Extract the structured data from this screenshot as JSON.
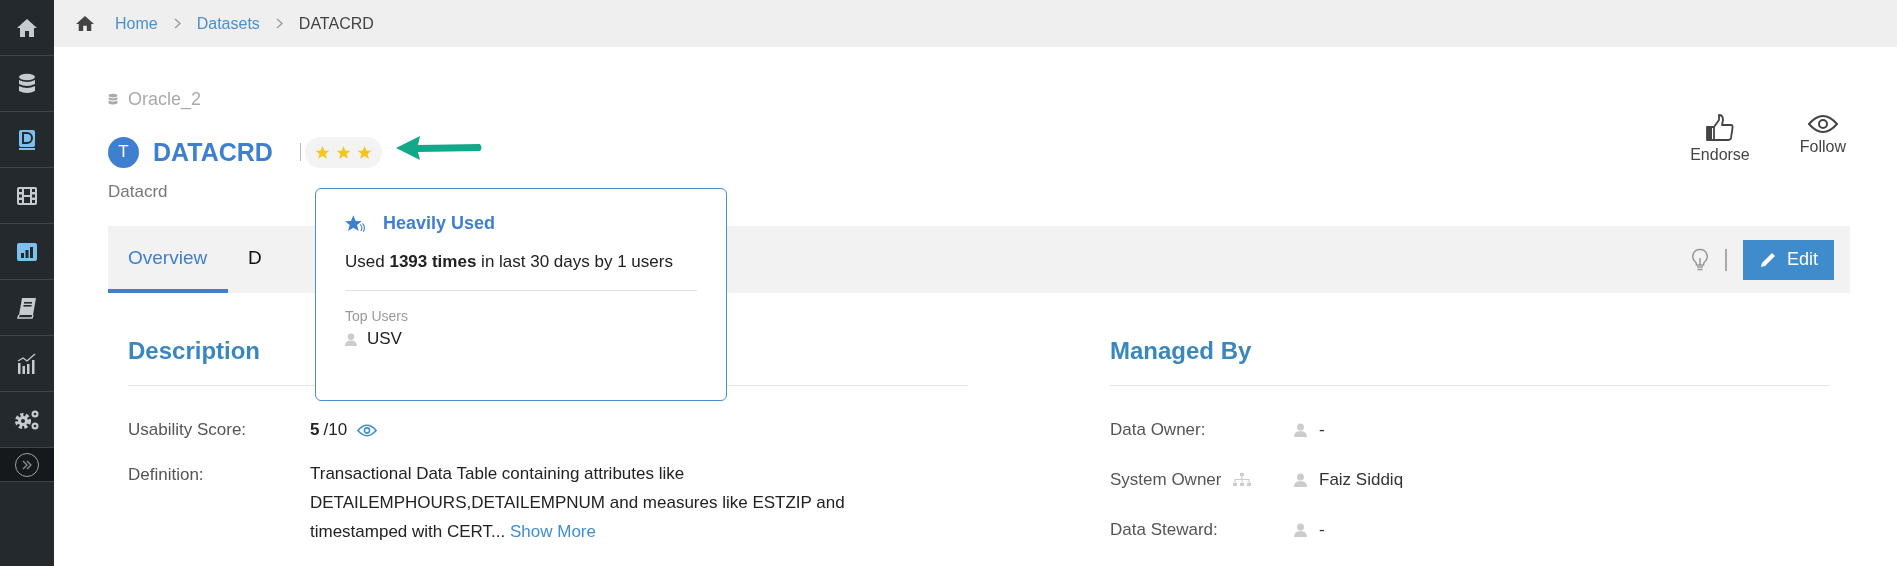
{
  "sidebar": {
    "items": [
      {
        "kind": "home"
      },
      {
        "kind": "database"
      },
      {
        "kind": "dictionary"
      },
      {
        "kind": "film"
      },
      {
        "kind": "chart"
      },
      {
        "kind": "book"
      },
      {
        "kind": "trend"
      },
      {
        "kind": "gears"
      }
    ]
  },
  "breadcrumb": [
    {
      "label": "Home",
      "link": true
    },
    {
      "label": "Datasets",
      "link": true
    },
    {
      "label": "DATACRD",
      "link": false
    }
  ],
  "header": {
    "source": "Oracle_2",
    "type_badge": "T",
    "title": "DATACRD",
    "stars": 3,
    "subtitle": "Datacrd",
    "actions": [
      {
        "kind": "endorse",
        "label": "Endorse"
      },
      {
        "kind": "follow",
        "label": "Follow"
      }
    ]
  },
  "tabs": [
    {
      "label": "Overview",
      "selected": true
    },
    {
      "label": "D",
      "selected": false
    }
  ],
  "edit_button": "Edit",
  "popover": {
    "title": "Heavily Used",
    "text": "Used **1393 times** in last 30 days by 1 users",
    "top_users_label": "Top Users",
    "top_users": [
      "USV"
    ]
  },
  "description": {
    "heading": "Description",
    "usability_label": "Usability Score:",
    "usability_score": "5",
    "usability_max": "/10",
    "definition_label": "Definition:",
    "definition": "Transactional Data Table containing attributes like DETAILEMPHOURS,DETAILEMPNUM and measures like ESTZIP and timestamped with CERT...",
    "show_more": "Show More"
  },
  "managed_by": {
    "heading": "Managed By",
    "rows": [
      {
        "label": "Data Owner:",
        "hierarchy_icon": false,
        "value": "-"
      },
      {
        "label": "System Owner",
        "hierarchy_icon": true,
        "value": "Faiz Siddiq"
      },
      {
        "label": "Data Steward:",
        "hierarchy_icon": false,
        "value": "-"
      }
    ]
  }
}
